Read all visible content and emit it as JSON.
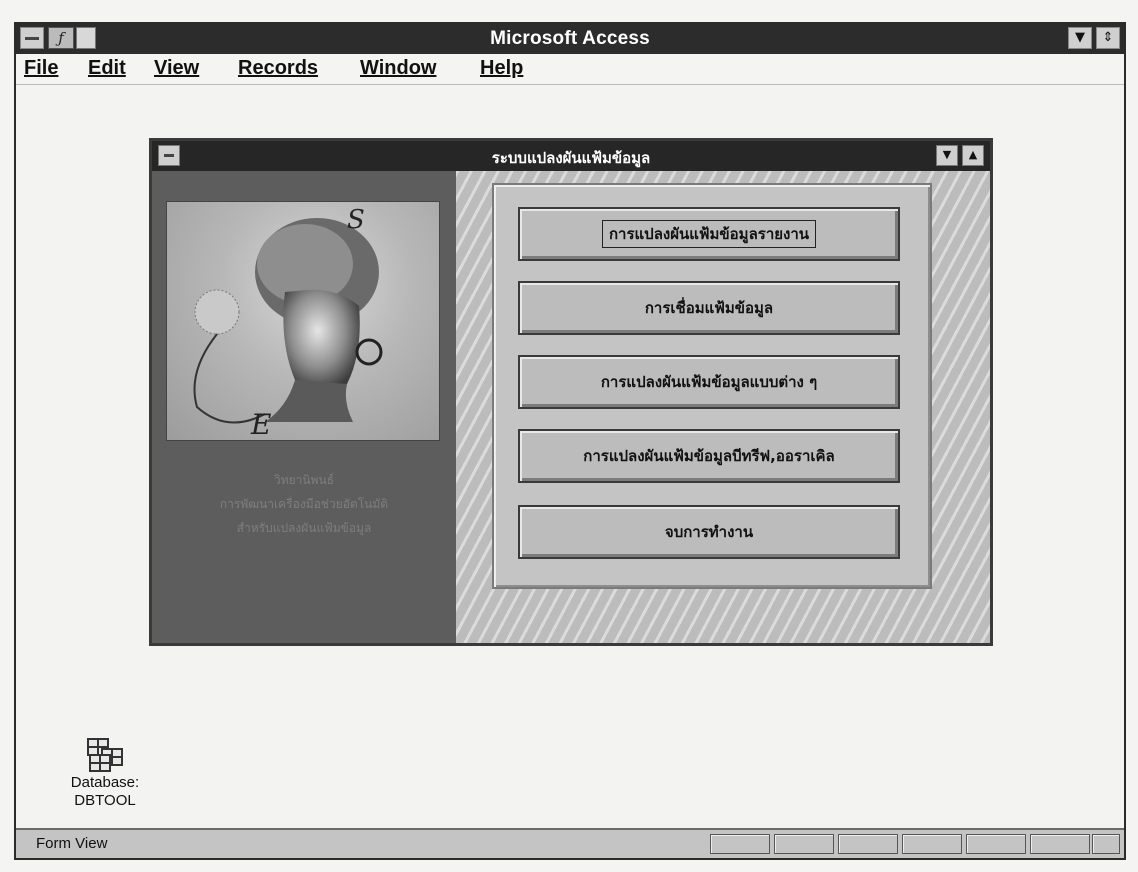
{
  "app": {
    "title": "Microsoft Access",
    "menu": [
      "File",
      "Edit",
      "View",
      "Records",
      "Window",
      "Help"
    ]
  },
  "form": {
    "title": "ระบบแปลงผันแฟ้มข้อมูล",
    "side_text": [
      "วิทยานิพนธ์",
      "การพัฒนาเครื่องมือช่วยอัตโนมัติ",
      "สำหรับแปลงผันแฟ้มข้อมูล"
    ],
    "picture_letters": [
      "S",
      "E",
      "O"
    ],
    "buttons": [
      "การแปลงผันแฟ้มข้อมูลรายงาน",
      "การเชื่อมแฟ้มข้อมูล",
      "การแปลงผันแฟ้มข้อมูลแบบต่าง ๆ",
      "การแปลงผันแฟ้มข้อมูลบีทรีฟ,ออราเคิล",
      "จบการทำงาน"
    ]
  },
  "database_icon": {
    "label_line1": "Database:",
    "label_line2": "DBTOOL"
  },
  "status": {
    "text": "Form View"
  },
  "icons": {
    "system_menu": "system-menu-icon",
    "minimize": "minimize-icon",
    "maximize": "maximize-icon",
    "database": "database-window-icon"
  }
}
